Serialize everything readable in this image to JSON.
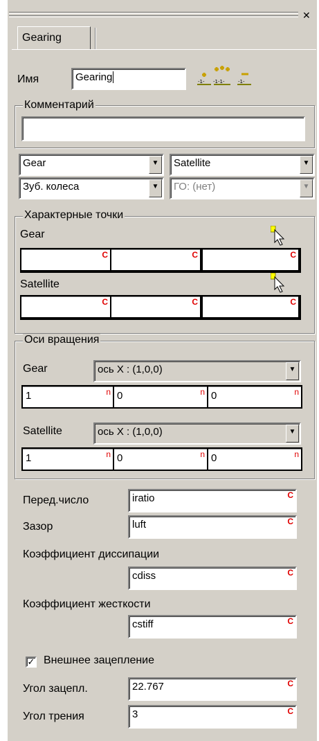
{
  "tab": {
    "label": "Gearing"
  },
  "name": {
    "label": "Имя",
    "value": "Gearing"
  },
  "comment": {
    "title": "Комментарий",
    "value": ""
  },
  "selectors": {
    "body1": "Gear",
    "body2": "Satellite",
    "type": "Зуб. колеса",
    "go": "ГО: (нет)"
  },
  "points": {
    "title": "Характерные точки",
    "gear_label": "Gear",
    "satellite_label": "Satellite",
    "mark": "C"
  },
  "axes": {
    "title": "Оси вращения",
    "gear_label": "Gear",
    "gear_axis": "ось X : (1,0,0)",
    "gear_values": [
      "1",
      "0",
      "0"
    ],
    "satellite_label": "Satellite",
    "satellite_axis": "ось X : (1,0,0)",
    "satellite_values": [
      "1",
      "0",
      "0"
    ],
    "mark": "n"
  },
  "params": {
    "ratio_label": "Перед.число",
    "ratio_value": "iratio",
    "gap_label": "Зазор",
    "gap_value": "luft",
    "diss_label": "Коэффициент диссипации",
    "diss_value": "cdiss",
    "stiff_label": "Коэффициент жесткости",
    "stiff_value": "cstiff",
    "external_label": "Внешнее зацепление",
    "external_checked": true,
    "angle_label": "Угол зацепл.",
    "angle_value": "22.767",
    "friction_label": "Угол трения",
    "friction_value": "3",
    "mark": "C"
  }
}
